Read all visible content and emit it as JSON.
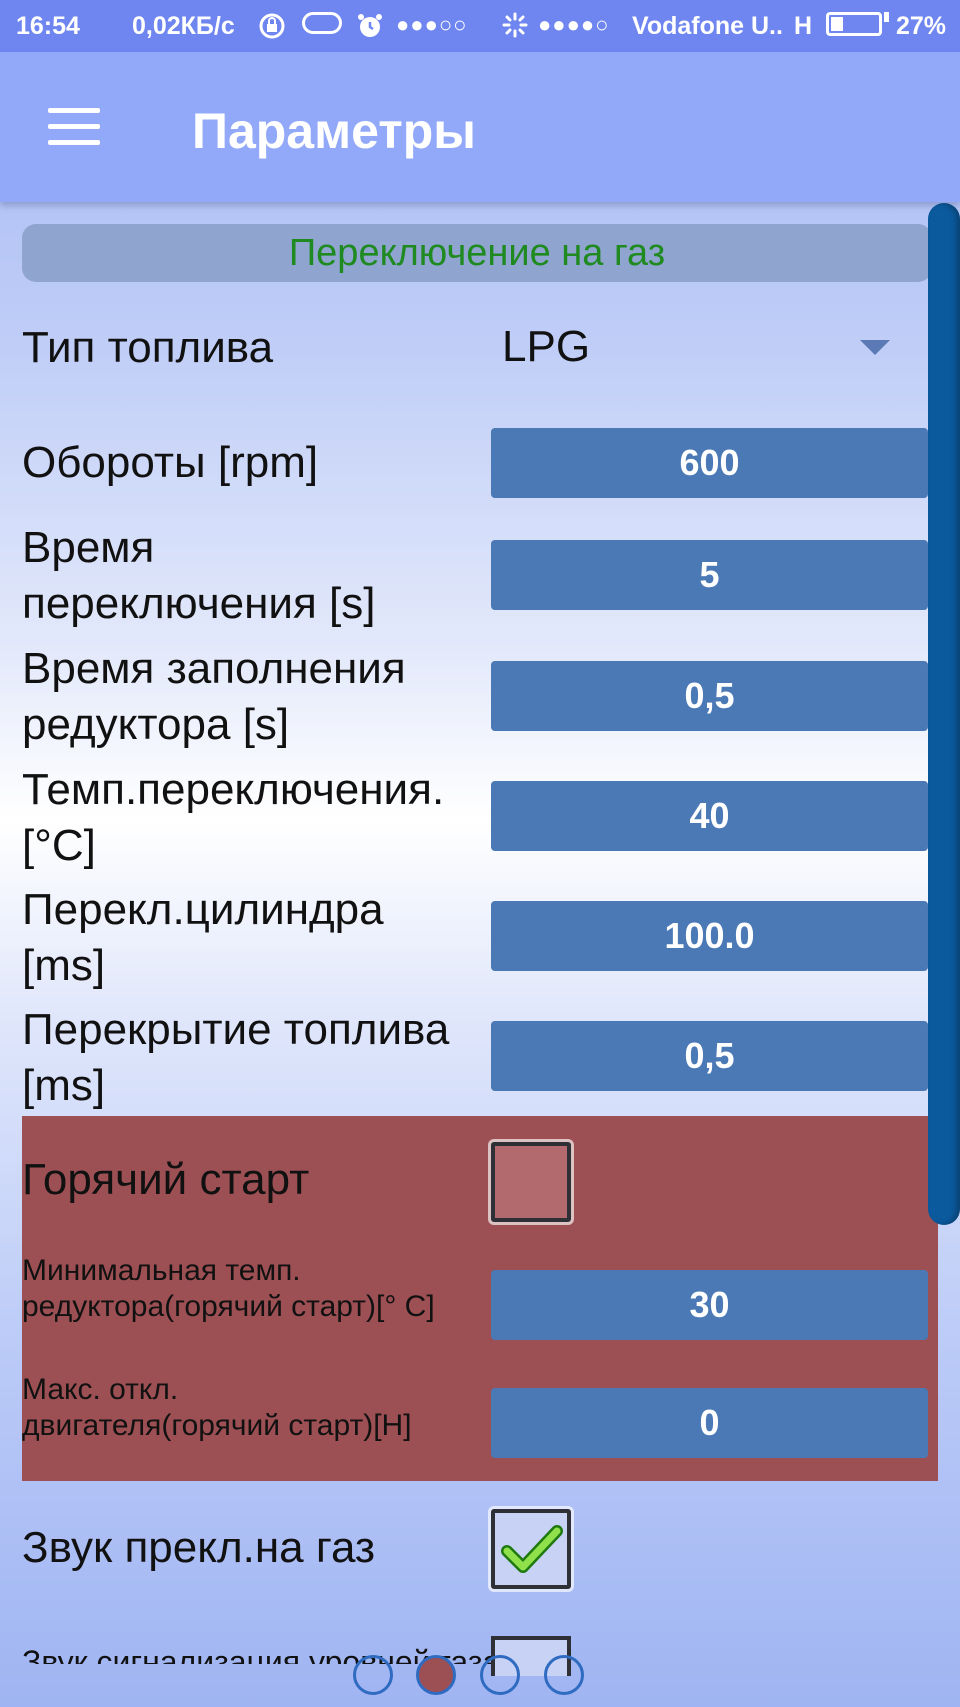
{
  "status_bar": {
    "time": "16:54",
    "speed": "0,02КБ/с",
    "signal1": "●●●○○",
    "signal2": "●●●●○",
    "carrier": "Vodafone U..",
    "network": "H",
    "battery": "27%"
  },
  "app_bar": {
    "title": "Параметры",
    "menu_icon": "hamburger-menu-icon"
  },
  "section": {
    "title": "Переключение на газ"
  },
  "fuel_type": {
    "label": "Тип топлива",
    "value": "LPG"
  },
  "params": [
    {
      "label": "Обороты [rpm]",
      "value": "600"
    },
    {
      "label_line1": "Время",
      "label_line2": "переключения [s]",
      "value": "5"
    },
    {
      "label_line1": "Время заполнения",
      "label_line2": "редуктора [s]",
      "value": "0,5"
    },
    {
      "label_line1": "Темп.переключения.",
      "label_line2": "[°C]",
      "value": "40"
    },
    {
      "label_line1": "Перекл.цилиндра",
      "label_line2": "[ms]",
      "value": "100.0"
    },
    {
      "label_line1": "Перекрытие топлива",
      "label_line2": "[ms]",
      "value": "0,5"
    }
  ],
  "hot_start": {
    "label": "Горячий старт",
    "checked": false,
    "min_temp": {
      "label_line1": "Минимальная темп.",
      "label_line2": "редуктора(горячий старт)[° C]",
      "value": "30"
    },
    "max_dev": {
      "label_line1": "Макс. откл.",
      "label_line2": "двигателя(горячий старт)[Н]",
      "value": "0"
    }
  },
  "sound_switch": {
    "label": "Звук прекл.на газ",
    "checked": true
  },
  "sound_level": {
    "label": "Звук сигнализация уровней газа",
    "checked": true
  },
  "pager": {
    "count": 4,
    "active_index": 1
  },
  "colors": {
    "status_bar": "#6f86f0",
    "app_bar": "#92a8f8",
    "field_bg": "#4a79b6",
    "hot_panel": "#9d5054",
    "section_text": "#1f8a1f",
    "scrollbar": "#0b5a9e"
  }
}
